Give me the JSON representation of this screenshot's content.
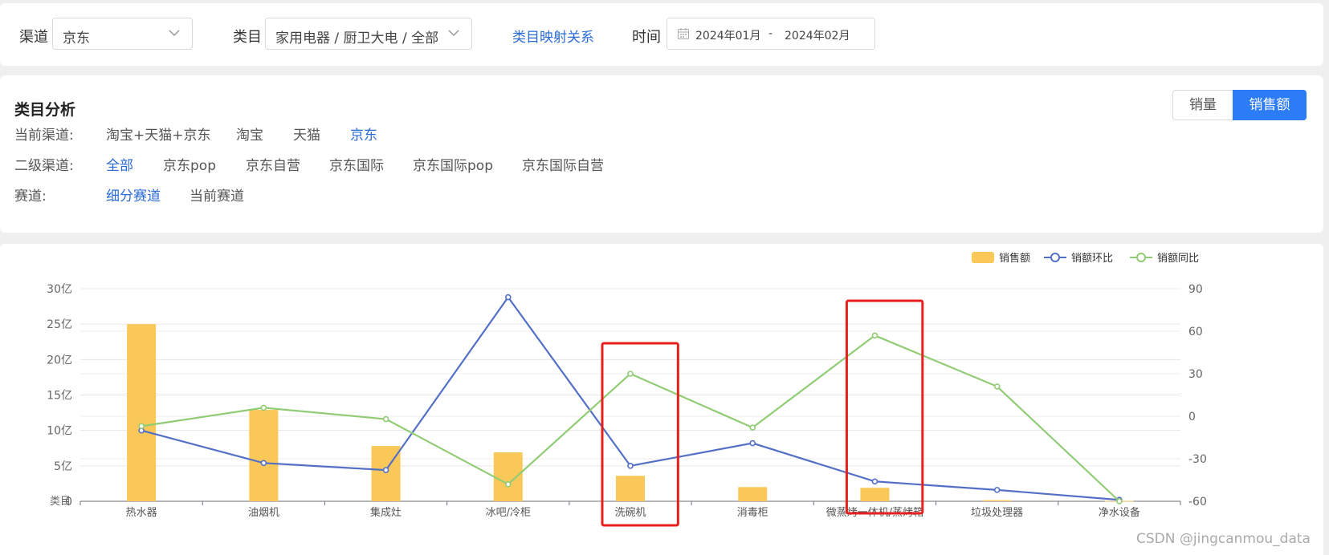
{
  "filter": {
    "channel_label": "渠道",
    "channel_value": "京东",
    "category_label": "类目",
    "category_value": "家用电器 / 厨卫大电 / 全部",
    "mapping_link": "类目映射关系",
    "time_label": "时间",
    "date_from": "2024年01月",
    "date_sep": "-",
    "date_to": "2024年02月"
  },
  "analysis": {
    "title": "类目分析",
    "toggle": {
      "volume": "销量",
      "sales": "销售额"
    },
    "rows": [
      {
        "label": "当前渠道:",
        "options": [
          "淘宝+天猫+京东",
          "淘宝",
          "天猫",
          "京东"
        ],
        "active": 3
      },
      {
        "label": "二级渠道:",
        "options": [
          "全部",
          "京东pop",
          "京东自营",
          "京东国际",
          "京东国际pop",
          "京东国际自营"
        ],
        "active": 0
      },
      {
        "label": "赛道:",
        "options": [
          "细分赛道",
          "当前赛道"
        ],
        "active": 0
      }
    ]
  },
  "chart_data": {
    "type": "bar",
    "categories": [
      "热水器",
      "油烟机",
      "集成灶",
      "冰吧/冷柜",
      "洗碗机",
      "消毒柜",
      "微蒸烤一体机/蒸烤箱",
      "垃圾处理器",
      "净水设备"
    ],
    "x_tick_labels": [
      "热水器",
      "油烟机",
      "集成灶",
      "冰吧/冷柜",
      "洗碗机",
      "消毒柜",
      "微蒸烤一体机/蒸烤箱",
      "垃圾处理器",
      "净水设备"
    ],
    "y_left": {
      "ticks": [
        "0",
        "5亿",
        "10亿",
        "15亿",
        "20亿",
        "25亿",
        "30亿"
      ],
      "lim": [
        0,
        30
      ],
      "axis_name": "类目"
    },
    "y_right": {
      "ticks": [
        "-60",
        "-30",
        "0",
        "30",
        "60",
        "90"
      ],
      "lim": [
        -60,
        90
      ]
    },
    "series": [
      {
        "name": "销售额",
        "type": "bar",
        "axis": "left",
        "color": "#fac858",
        "values": [
          25.0,
          12.9,
          7.8,
          6.9,
          3.6,
          2.0,
          1.9,
          0.15,
          0.05
        ]
      },
      {
        "name": "销额环比",
        "type": "line",
        "axis": "right",
        "color": "#5470c6",
        "values": [
          -10,
          -33,
          -38,
          84,
          -35,
          -19,
          -46,
          -52,
          -59
        ]
      },
      {
        "name": "销额同比",
        "type": "line",
        "axis": "right",
        "color": "#91cc75",
        "values": [
          -7,
          6,
          -2,
          -48,
          30,
          -8,
          57,
          21,
          -60
        ]
      }
    ],
    "grid": true,
    "legend": "top-right",
    "highlight_color": "#e8201d",
    "highlights": [
      [
        4,
        4
      ],
      [
        6,
        6
      ]
    ]
  },
  "watermark": "CSDN @jingcanmou_data"
}
